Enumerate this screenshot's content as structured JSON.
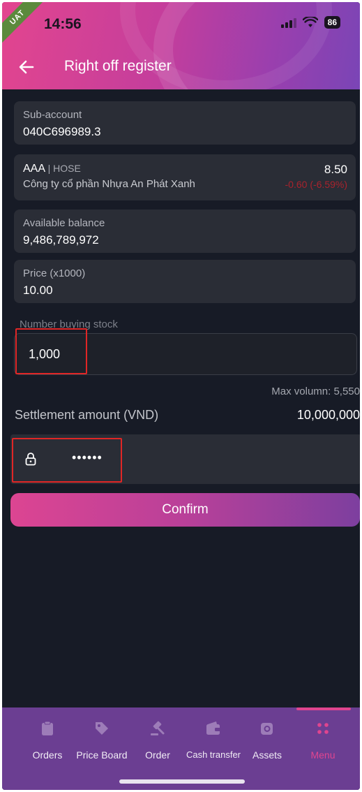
{
  "status": {
    "time": "14:56",
    "battery": "86",
    "env_badge": "UAT"
  },
  "header": {
    "title": "Right off register"
  },
  "sub_account": {
    "label": "Sub-account",
    "value": "040C696989.3"
  },
  "stock": {
    "symbol": "AAA",
    "exchange": "| HOSE",
    "name": "Công ty cổ phần Nhựa An Phát Xanh",
    "price": "8.50",
    "change": "-0.60 (-6.59%)",
    "change_color": "#a8232d"
  },
  "balance": {
    "label": "Available balance",
    "value": "9,486,789,972"
  },
  "price": {
    "label": "Price (x1000)",
    "value": "10.00"
  },
  "quantity": {
    "label": "Number buying stock",
    "value": "1,000"
  },
  "max_volume": "Max volumn: 5,550",
  "settlement": {
    "label": "Settlement amount (VND)",
    "value": "10,000,000"
  },
  "pin": {
    "masked": "••••••"
  },
  "confirm_label": "Confirm",
  "colors": {
    "accent": "#e0458f",
    "background": "#171b26",
    "nav": "#6b3e92"
  },
  "nav": {
    "items": [
      {
        "label": "Orders",
        "icon": "clipboard-icon"
      },
      {
        "label": "Price Board",
        "icon": "tag-icon"
      },
      {
        "label": "Order",
        "icon": "gavel-icon"
      },
      {
        "label": "Cash transfer",
        "icon": "wallet-icon"
      },
      {
        "label": "Assets",
        "icon": "coins-icon"
      },
      {
        "label": "Menu",
        "icon": "grid-icon",
        "active": true
      }
    ]
  }
}
